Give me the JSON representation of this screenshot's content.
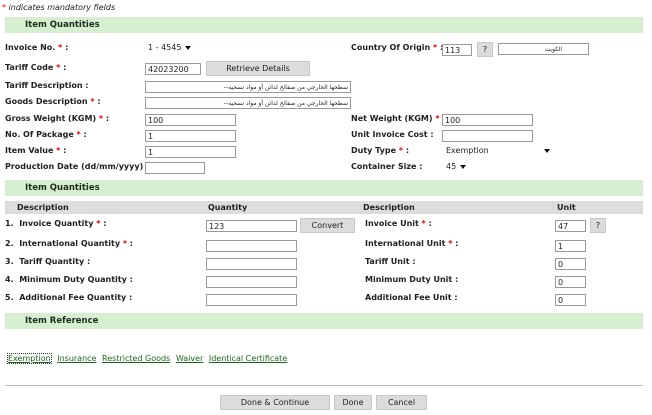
{
  "note": {
    "mark": "*",
    "text": "indicates mandatory fields"
  },
  "sections": {
    "qty1": "Item Quantities",
    "qty2": "Item Quantities",
    "ref": "Item Reference"
  },
  "form": {
    "invoice_no": {
      "label": "Invoice No.",
      "value": "1 - 4545"
    },
    "tariff_code": {
      "label": "Tariff Code",
      "value": "42023200",
      "button": "Retrieve Details"
    },
    "tariff_desc": {
      "label": "Tariff Description :",
      "value": "سطحها الخارجي من صفائح لدائن أو مواد نسجيه--"
    },
    "goods_desc": {
      "label": "Goods Description",
      "value": "سطحها الخارجي من صفائح لدائن أو مواد نسجيه--"
    },
    "gross_weight": {
      "label": "Gross Weight (KGM)",
      "value": "100"
    },
    "no_package": {
      "label": "No. Of Package",
      "value": "1"
    },
    "item_value": {
      "label": "Item Value",
      "value": "1"
    },
    "production_date": {
      "label": "Production Date (dd/mm/yyyy) :",
      "value": ""
    },
    "country": {
      "label": "Country Of Origin",
      "code": "113",
      "help": "?",
      "name": "الكويت"
    },
    "net_weight": {
      "label": "Net Weight (KGM)",
      "value": "100"
    },
    "unit_cost": {
      "label": "Unit Invoice Cost :",
      "value": ""
    },
    "duty_type": {
      "label": "Duty Type",
      "value": "Exemption"
    },
    "container_size": {
      "label": "Container Size :",
      "value": "45"
    }
  },
  "table": {
    "headers": [
      "Description",
      "Quantity",
      "Description",
      "Unit"
    ],
    "rows": [
      {
        "num": "1.",
        "qty_label": "Invoice Quantity",
        "qty_req": true,
        "qty_value": "123",
        "unit_label": "Invoice Unit",
        "unit_req": true,
        "unit_value": "47"
      },
      {
        "num": "2.",
        "qty_label": "International Quantity",
        "qty_req": true,
        "qty_value": "",
        "unit_label": "International Unit",
        "unit_req": true,
        "unit_value": "1"
      },
      {
        "num": "3.",
        "qty_label": "Tariff Quantity :",
        "qty_req": false,
        "qty_value": "",
        "unit_label": "Tariff Unit :",
        "unit_req": false,
        "unit_value": "0"
      },
      {
        "num": "4.",
        "qty_label": "Minimum Duty Quantity :",
        "qty_req": false,
        "qty_value": "",
        "unit_label": "Minimum Duty Unit :",
        "unit_req": false,
        "unit_value": "0"
      },
      {
        "num": "5.",
        "qty_label": "Additional Fee Quantity :",
        "qty_req": false,
        "qty_value": "",
        "unit_label": "Additional Fee Unit :",
        "unit_req": false,
        "unit_value": "0"
      }
    ],
    "convert": "Convert",
    "help": "?"
  },
  "links": [
    "Exemption",
    "Insurance",
    "Restricted Goods",
    "Waiver",
    "Identical Certificate"
  ],
  "buttons": {
    "done_continue": "Done & Continue",
    "done": "Done",
    "cancel": "Cancel"
  },
  "colors": {
    "section_bg": "#d6efd0",
    "required": "#e00000",
    "link": "#1a6a1a",
    "header_bg": "#dcdcdc"
  }
}
